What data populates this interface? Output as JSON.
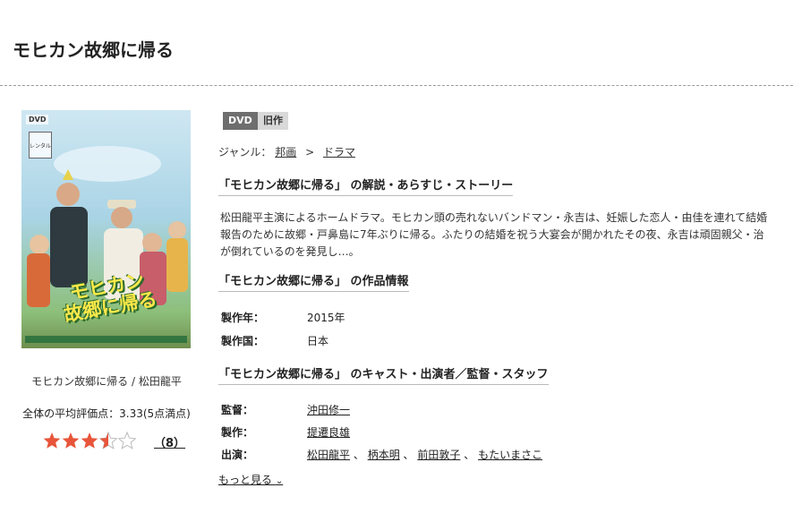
{
  "header": {
    "title": "モヒカン故郷に帰る"
  },
  "poster": {
    "dvd_badge": "DVD",
    "rental_badge": "レンタル",
    "title_line1": "モヒカン",
    "title_line2": "故郷に帰る"
  },
  "sidebar": {
    "caption": "モヒカン故郷に帰る / 松田龍平",
    "rating_text": "全体の平均評価点：3.33(5点満点)",
    "rating_value": 3.33,
    "rating_max": 5,
    "review_count": "（8）"
  },
  "tags": {
    "format": "DVD",
    "category": "旧作"
  },
  "genre": {
    "label": "ジャンル：",
    "primary": "邦画",
    "separator": ">",
    "secondary": "ドラマ"
  },
  "synopsis": {
    "heading": "「モヒカン故郷に帰る」 の解説・あらすじ・ストーリー",
    "text": "松田龍平主演によるホームドラマ。モヒカン頭の売れないバンドマン・永吉は、妊娠した恋人・由佳を連れて結婚報告のために故郷・戸鼻島に7年ぶりに帰る。ふたりの結婚を祝う大宴会が開かれたその夜、永吉は頑固親父・治が倒れているのを発見し…。"
  },
  "work_info": {
    "heading": "「モヒカン故郷に帰る」 の作品情報",
    "year_label": "製作年：",
    "year_value": "2015年",
    "country_label": "製作国：",
    "country_value": "日本"
  },
  "cast": {
    "heading": "「モヒカン故郷に帰る」 のキャスト・出演者／監督・スタッフ",
    "director_label": "監督：",
    "director": "沖田修一",
    "producer_label": "製作：",
    "producer": "提遷良雄",
    "actors_label": "出演：",
    "actors": [
      "松田龍平",
      "柄本明",
      "前田敦子",
      "もたいまさこ"
    ],
    "separator": "、",
    "more_label": "もっと見る",
    "more_icon": "⌄"
  },
  "colors": {
    "tag_dvd_bg": "#6e6e6e",
    "tag_old_bg": "#d9d9d9",
    "star_fill": "#e8553a"
  }
}
